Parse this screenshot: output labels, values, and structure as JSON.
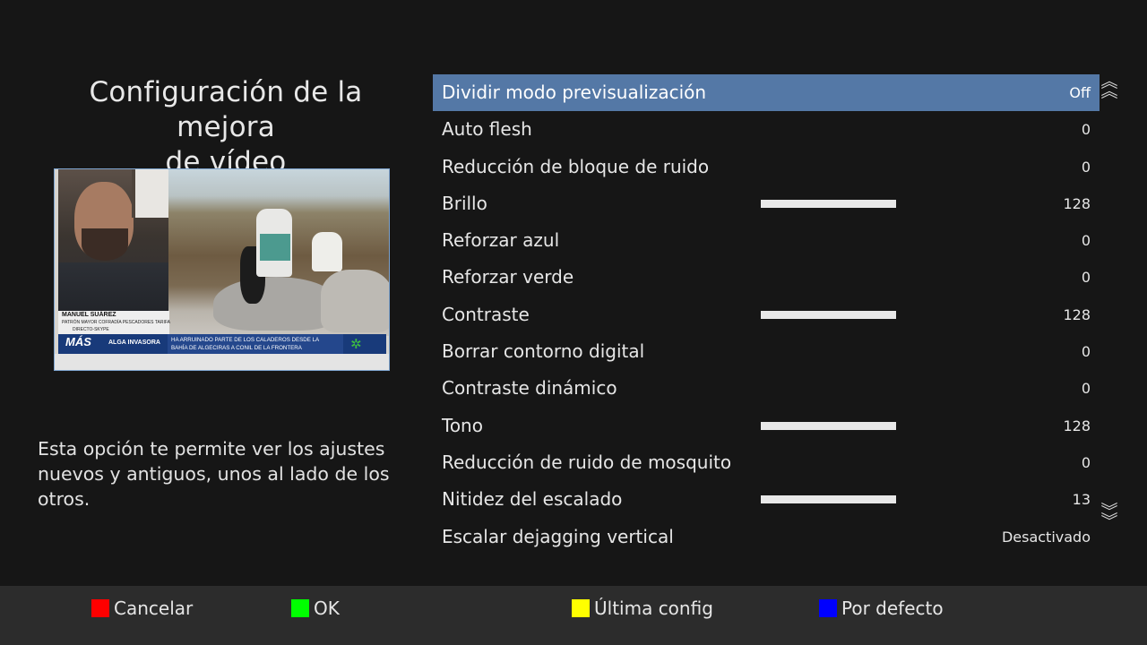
{
  "header": {
    "title_line1": "Configuración de la mejora",
    "title_line2": "de vídeo"
  },
  "preview": {
    "name": "MANUEL SUÁREZ",
    "role": "PATRÓN MAYOR COFRADÍA PESCADORES TARIFA",
    "source": "DIRECTO-SKYPE",
    "channel_logo": "MÁS",
    "tag": "ALGA INVASORA",
    "headline_line1": "HA ARRUINADO PARTE DE LOS CALADEROS DESDE LA",
    "headline_line2": "BAHÍA DE ALGECIRAS A CONIL DE LA FRONTERA"
  },
  "description": {
    "line1": "Esta opción te permite ver los ajustes",
    "line2": "nuevos y antiguos, unos al lado de los otros."
  },
  "menu": {
    "items": [
      {
        "label": "Dividir modo previsualización",
        "value": "Off",
        "selected": true
      },
      {
        "label": "Auto flesh",
        "value": "0"
      },
      {
        "label": "Reducción de bloque de ruido",
        "value": "0"
      },
      {
        "label": "Brillo",
        "value": "128",
        "slider": 1.0
      },
      {
        "label": "Reforzar azul",
        "value": "0"
      },
      {
        "label": "Reforzar verde",
        "value": "0"
      },
      {
        "label": "Contraste",
        "value": "128",
        "slider": 1.0
      },
      {
        "label": "Borrar contorno digital",
        "value": "0"
      },
      {
        "label": "Contraste dinámico",
        "value": "0"
      },
      {
        "label": "Tono",
        "value": "128",
        "slider": 1.0
      },
      {
        "label": "Reducción de ruido de mosquito",
        "value": "0"
      },
      {
        "label": "Nitidez del escalado",
        "value": "13",
        "slider": 1.0
      },
      {
        "label": "Escalar dejagging vertical",
        "value": "Desactivado"
      }
    ],
    "selected_color": "#5478a6",
    "scroll_up_icon": "chevron-up-double-icon",
    "scroll_down_icon": "chevron-down-double-icon"
  },
  "footer": {
    "buttons": [
      {
        "label": "Cancelar",
        "color": "#ff0000"
      },
      {
        "label": "OK",
        "color": "#00ff00"
      },
      {
        "label": "Última config",
        "color": "#ffff00"
      },
      {
        "label": "Por defecto",
        "color": "#0000ff"
      }
    ]
  }
}
